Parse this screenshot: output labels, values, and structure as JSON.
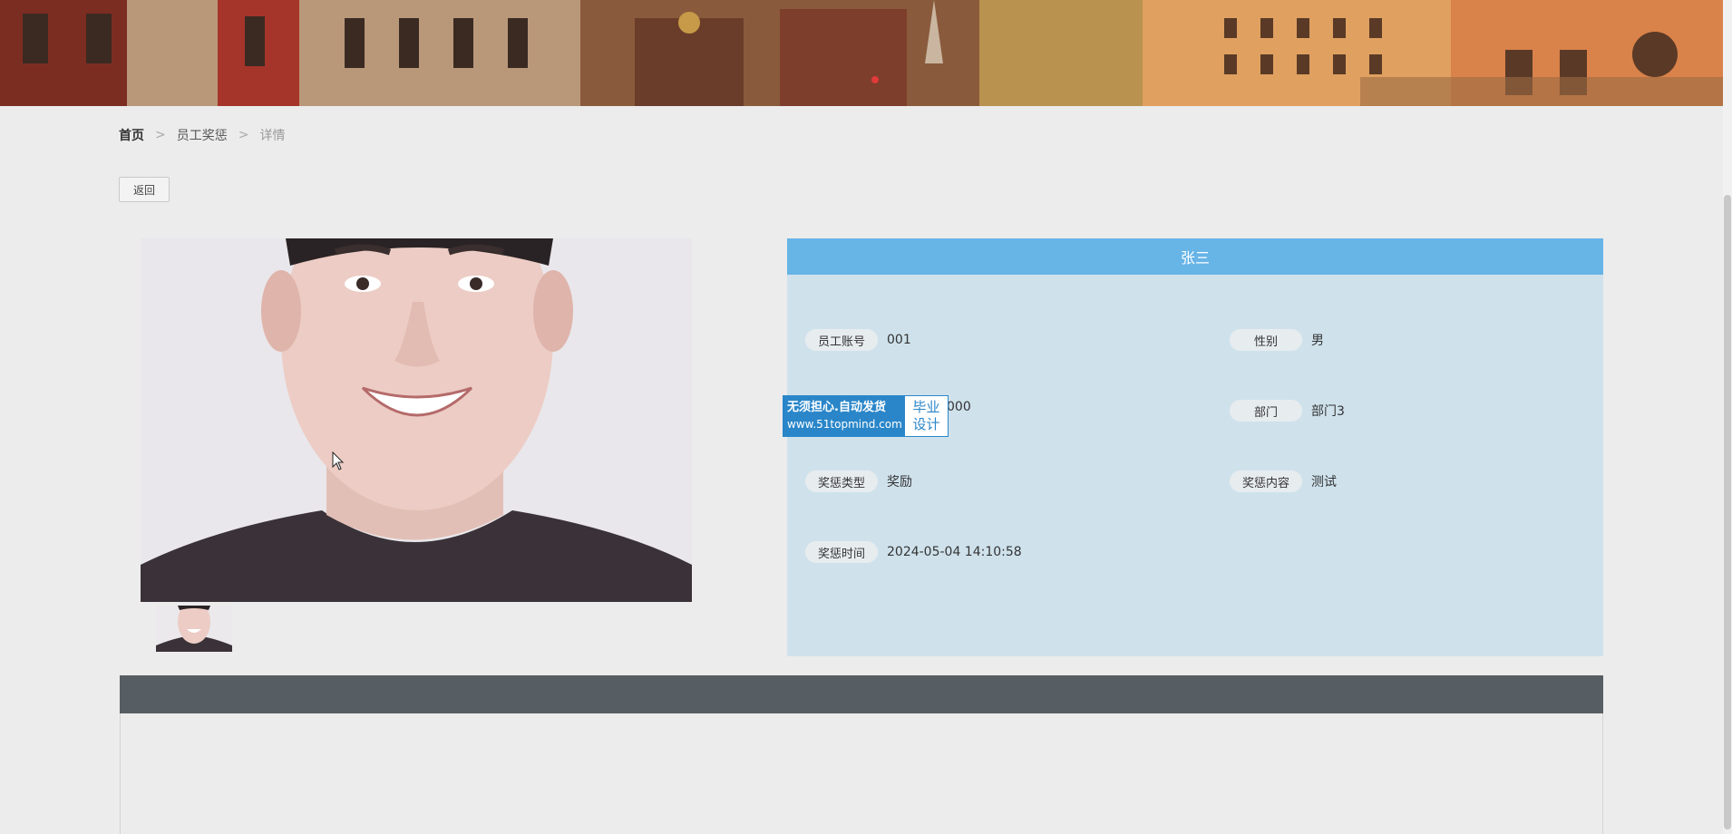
{
  "breadcrumb": {
    "home": "首页",
    "section": "员工奖惩",
    "current": "详情",
    "separator": ">"
  },
  "back_button": "返回",
  "record": {
    "name": "张三",
    "fields": {
      "account": {
        "label": "员工账号",
        "value": "001"
      },
      "gender": {
        "label": "性别",
        "value": "男"
      },
      "hidden_value": "000",
      "department": {
        "label": "部门",
        "value": "部门3"
      },
      "type": {
        "label": "奖惩类型",
        "value": "奖励"
      },
      "content": {
        "label": "奖惩内容",
        "value": "测试"
      },
      "time": {
        "label": "奖惩时间",
        "value": "2024-05-04 14:10:58"
      }
    }
  },
  "watermark": {
    "line1": "无须担心.自动发货",
    "line2": "www.51topmind.com",
    "right1": "毕业",
    "right2": "设计"
  },
  "colors": {
    "header_blue": "#67b4e7",
    "panel_bg": "#cfe2ec",
    "bottom_bar": "#575e63"
  }
}
